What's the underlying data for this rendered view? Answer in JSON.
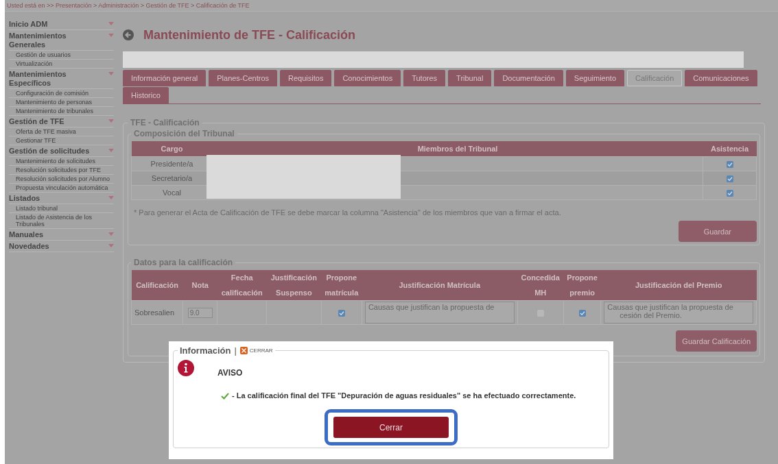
{
  "breadcrumb": "Usted está en >> Presentación > Administración > Gestión de TFE > Calificación de TFE",
  "sidebar": {
    "sections": [
      {
        "title": "Inicio ADM"
      },
      {
        "title": "Mantenimientos Generales",
        "children": [
          "Gestión de usuarios",
          "Virtualización"
        ]
      },
      {
        "title": "Mantenimientos Específicos",
        "children": [
          "Configuración de comisión",
          "Mantenimiento de personas",
          "Mantenimiento de tribunales"
        ]
      },
      {
        "title": "Gestión de TFE",
        "children": [
          "Oferta de TFE masiva",
          "Gestionar TFE"
        ]
      },
      {
        "title": "Gestión de solicitudes",
        "children": [
          "Mantenimiento de solicitudes",
          "Resolución solicitudes por TFE",
          "Resolución solicitudes por Alumno",
          "Propuesta vinculación automática"
        ]
      },
      {
        "title": "Listados",
        "children": [
          "Listado tribunal",
          "Listado de Asistencia de los Tribunales"
        ]
      },
      {
        "title": "Manuales"
      },
      {
        "title": "Novedades"
      }
    ]
  },
  "page_title": "Mantenimiento de TFE - Calificación",
  "tabs": [
    {
      "label": "Información general",
      "selected": false
    },
    {
      "label": "Planes-Centros",
      "selected": false
    },
    {
      "label": "Requisitos",
      "selected": false
    },
    {
      "label": "Conocimientos",
      "selected": false
    },
    {
      "label": "Tutores",
      "selected": false
    },
    {
      "label": "Tribunal",
      "selected": false
    },
    {
      "label": "Documentación",
      "selected": false
    },
    {
      "label": "Seguimiento",
      "selected": false
    },
    {
      "label": "Calificación",
      "selected": true
    },
    {
      "label": "Comunicaciones",
      "selected": false
    },
    {
      "label": "Historico",
      "selected": false
    }
  ],
  "section_title": "TFE - Calificación",
  "tribunal": {
    "title": "Composición del Tribunal",
    "columns": [
      "Cargo",
      "Miembros del Tribunal",
      "Asistencia"
    ],
    "rows": [
      {
        "cargo": "Presidente/a",
        "checked": true
      },
      {
        "cargo": "Secretario/a",
        "checked": true
      },
      {
        "cargo": "Vocal",
        "checked": true
      }
    ],
    "note": "* Para generar el Acta de Calificación de TFE se debe marcar la columna \"Asistencia\" de los miembros que van a firmar el acta.",
    "save_button": "Guardar"
  },
  "grading": {
    "title": "Datos para la calificación",
    "columns": [
      [
        "Calificación"
      ],
      [
        "Nota"
      ],
      [
        "Fecha",
        "calificación"
      ],
      [
        "Justificación",
        "Suspenso"
      ],
      [
        "Propone",
        "matrícula"
      ],
      [
        "Justificación Matrícula"
      ],
      [
        "Concedida",
        "MH"
      ],
      [
        "Propone",
        "premio"
      ],
      [
        "Justificación del Premio"
      ]
    ],
    "row": {
      "calificacion": "Sobresalien",
      "nota": "9.0",
      "propone_matricula": true,
      "justificacion_matricula": "Causas que justifican la propuesta de",
      "concedida_mh": false,
      "propone_premio": true,
      "justificacion_premio": [
        "Causas que justifican la propuesta de",
        "cesión del Premio."
      ]
    },
    "save_button": "Guardar Calificación"
  },
  "dialog": {
    "title": "Información",
    "separator": "|",
    "close_label": "CERRAR",
    "heading": "AVISO",
    "message": "- La calificación final del TFE \"Depuración de aguas residuales\" se ha efectuado correctamente.",
    "button": "Cerrar"
  }
}
